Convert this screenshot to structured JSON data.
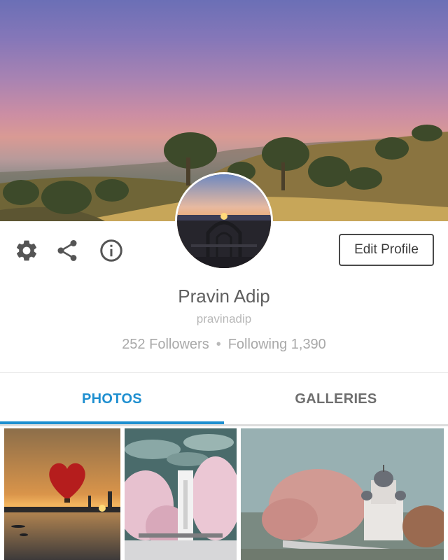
{
  "profile": {
    "name": "Pravin Adip",
    "username": "pravinadip",
    "followers_label": "252 Followers",
    "separator": "•",
    "following_label": "Following 1,390"
  },
  "actions": {
    "edit_profile_label": "Edit Profile",
    "icons": [
      "gear-icon",
      "share-icon",
      "info-icon"
    ]
  },
  "tabs": [
    {
      "label": "PHOTOS",
      "active": true
    },
    {
      "label": "GALLERIES",
      "active": false
    }
  ],
  "colors": {
    "accent": "#1e8fd0",
    "name_text": "#5f5f5f",
    "muted_text": "#a9a9a9"
  },
  "photos": [
    {
      "subject": "hot air balloon heart at sunset over lake"
    },
    {
      "subject": "pink infrared trees with white tower"
    },
    {
      "subject": "pink trees with church dome"
    }
  ]
}
